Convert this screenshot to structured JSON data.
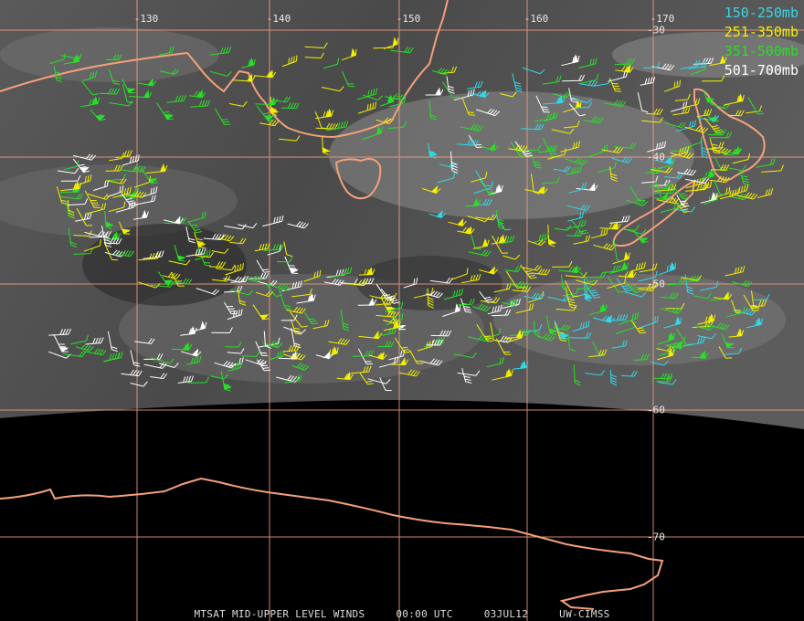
{
  "legend": {
    "items": [
      {
        "label": "150-250mb",
        "color": "#33d8e8"
      },
      {
        "label": "251-350mb",
        "color": "#f4f000"
      },
      {
        "label": "351-500mb",
        "color": "#28e028"
      },
      {
        "label": "501-700mb",
        "color": "#ffffff"
      }
    ]
  },
  "longitude_labels": [
    "-130",
    "-140",
    "-150",
    "-160",
    "-170"
  ],
  "latitude_labels": [
    "-30",
    "-40",
    "-50",
    "-60",
    "-70"
  ],
  "caption": {
    "product": "MTSAT MID-UPPER LEVEL WINDS",
    "time": "00:00 UTC",
    "date": "03JUL12",
    "source": "UW-CIMSS"
  },
  "colors": {
    "gridlines": "#f0a080",
    "coastline": "#f4a07a",
    "space": "#000000"
  }
}
